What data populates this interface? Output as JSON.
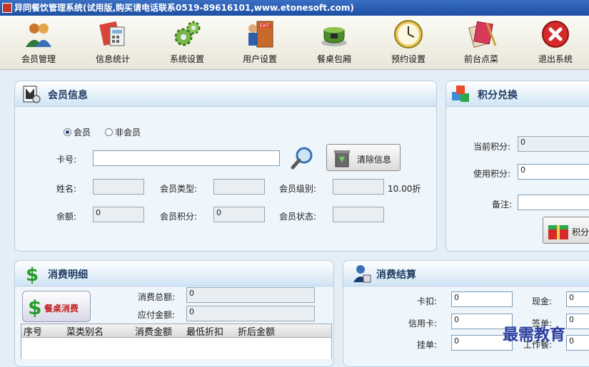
{
  "window": {
    "title": "异同餐饮管理系统(试用版,购买请电话联系0519-89616101,www.etonesoft.com)"
  },
  "toolbar": [
    {
      "label": "会员管理",
      "icon": "members-icon"
    },
    {
      "label": "信息统计",
      "icon": "statistics-icon"
    },
    {
      "label": "系统设置",
      "icon": "gears-icon"
    },
    {
      "label": "用户设置",
      "icon": "user-exit-icon"
    },
    {
      "label": "餐桌包厢",
      "icon": "tea-cup-icon"
    },
    {
      "label": "预约设置",
      "icon": "clock-icon"
    },
    {
      "label": "前台点菜",
      "icon": "menu-order-icon"
    },
    {
      "label": "退出系统",
      "icon": "exit-icon"
    }
  ],
  "member_info": {
    "title": "会员信息",
    "radio_member": "会员",
    "radio_non_member": "非会员",
    "card_label": "卡号:",
    "card_value": "",
    "clear_button": "清除信息",
    "name_label": "姓名:",
    "name_value": "",
    "type_label": "会员类型:",
    "type_value": "",
    "level_label": "会员级别:",
    "level_value": "",
    "discount_text": "10.00折",
    "balance_label": "余额:",
    "balance_value": "0",
    "points_label": "会员积分:",
    "points_value": "0",
    "status_label": "会员状态:",
    "status_value": ""
  },
  "points_exchange": {
    "title": "积分兑换",
    "current_label": "当前积分:",
    "current_value": "0",
    "use_label": "使用积分:",
    "use_value": "0",
    "remark_label": "备注:",
    "remark_value": "",
    "button_label": "积分"
  },
  "consumption": {
    "title": "消费明细",
    "table_button": "餐桌消费",
    "total_label": "消费总额:",
    "total_value": "0",
    "payable_label": "应付金额:",
    "payable_value": "0",
    "columns": [
      "序号",
      "菜类别名",
      "消费金额",
      "最低折扣",
      "折后金额"
    ]
  },
  "settlement": {
    "title": "消费结算",
    "card_deduct_label": "卡扣:",
    "card_deduct_value": "0",
    "credit_label": "信用卡:",
    "credit_value": "0",
    "charge_label": "挂单:",
    "charge_value": "0",
    "cash_label": "现金:",
    "cash_value": "0",
    "sign_label": "签单:",
    "sign_value": "0",
    "work_meal_label": "工作餐:",
    "work_meal_value": "0"
  },
  "watermark": "最需教育"
}
